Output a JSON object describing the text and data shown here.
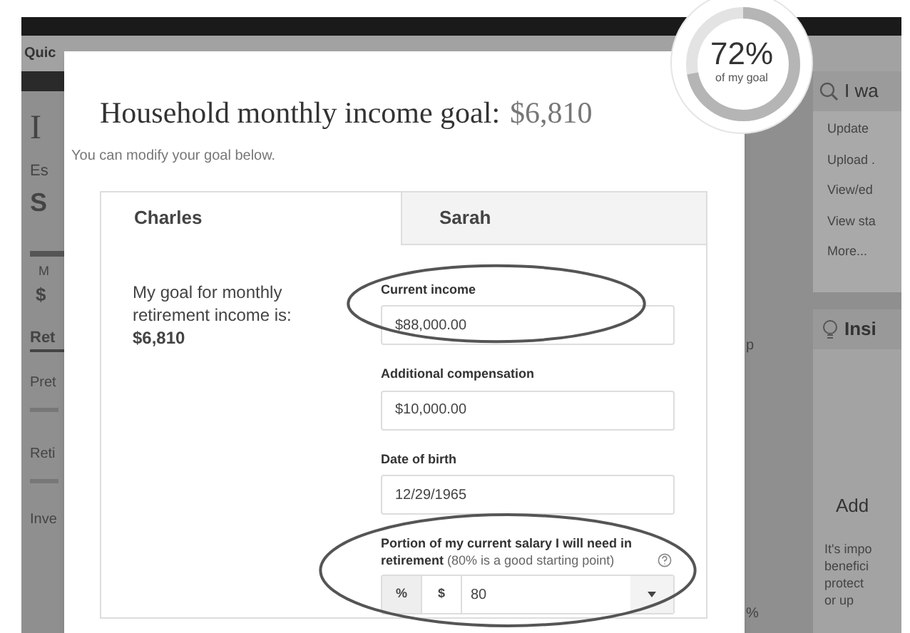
{
  "nav": {
    "quick_link": "Quic"
  },
  "background": {
    "left_texts": [
      "I",
      "Es",
      "S",
      "M",
      "$",
      "Ret",
      "Pret",
      "Reti",
      "Inve"
    ],
    "middle_texts": [
      "p",
      "%"
    ],
    "actions_panel": {
      "title": "I wa",
      "items": [
        "Update",
        "Upload .",
        "View/ed",
        "View sta",
        "More..."
      ]
    },
    "insights_panel": {
      "title": "Insi",
      "heading": "Add",
      "body_lines": [
        "It's impo",
        "benefici",
        "protect",
        "or up"
      ]
    }
  },
  "modal": {
    "title": "Household monthly income goal:",
    "goal_amount": "$6,810",
    "subtitle": "You can modify your goal below.",
    "tabs": [
      {
        "label": "Charles",
        "selected": true
      },
      {
        "label": "Sarah",
        "selected": false
      }
    ],
    "goal_label": "My goal for monthly retirement income is:",
    "goal_value": "$6,810",
    "fields": [
      {
        "label": "Current income",
        "value": "$88,000.00",
        "circled": true
      },
      {
        "label": "Additional compensation",
        "value": "$10,000.00",
        "circled": false
      },
      {
        "label": "Date of birth",
        "value": "12/29/1965",
        "circled": false
      }
    ],
    "portion": {
      "label": "Portion of my current salary I will need in retirement",
      "hint": "(80% is a good starting point)",
      "units": [
        {
          "label": "%",
          "selected": true
        },
        {
          "label": "$",
          "selected": false
        }
      ],
      "value": "80",
      "circled": true
    }
  },
  "progress_badge": {
    "percent": "72%",
    "caption": "of my goal",
    "level": 0.72
  }
}
